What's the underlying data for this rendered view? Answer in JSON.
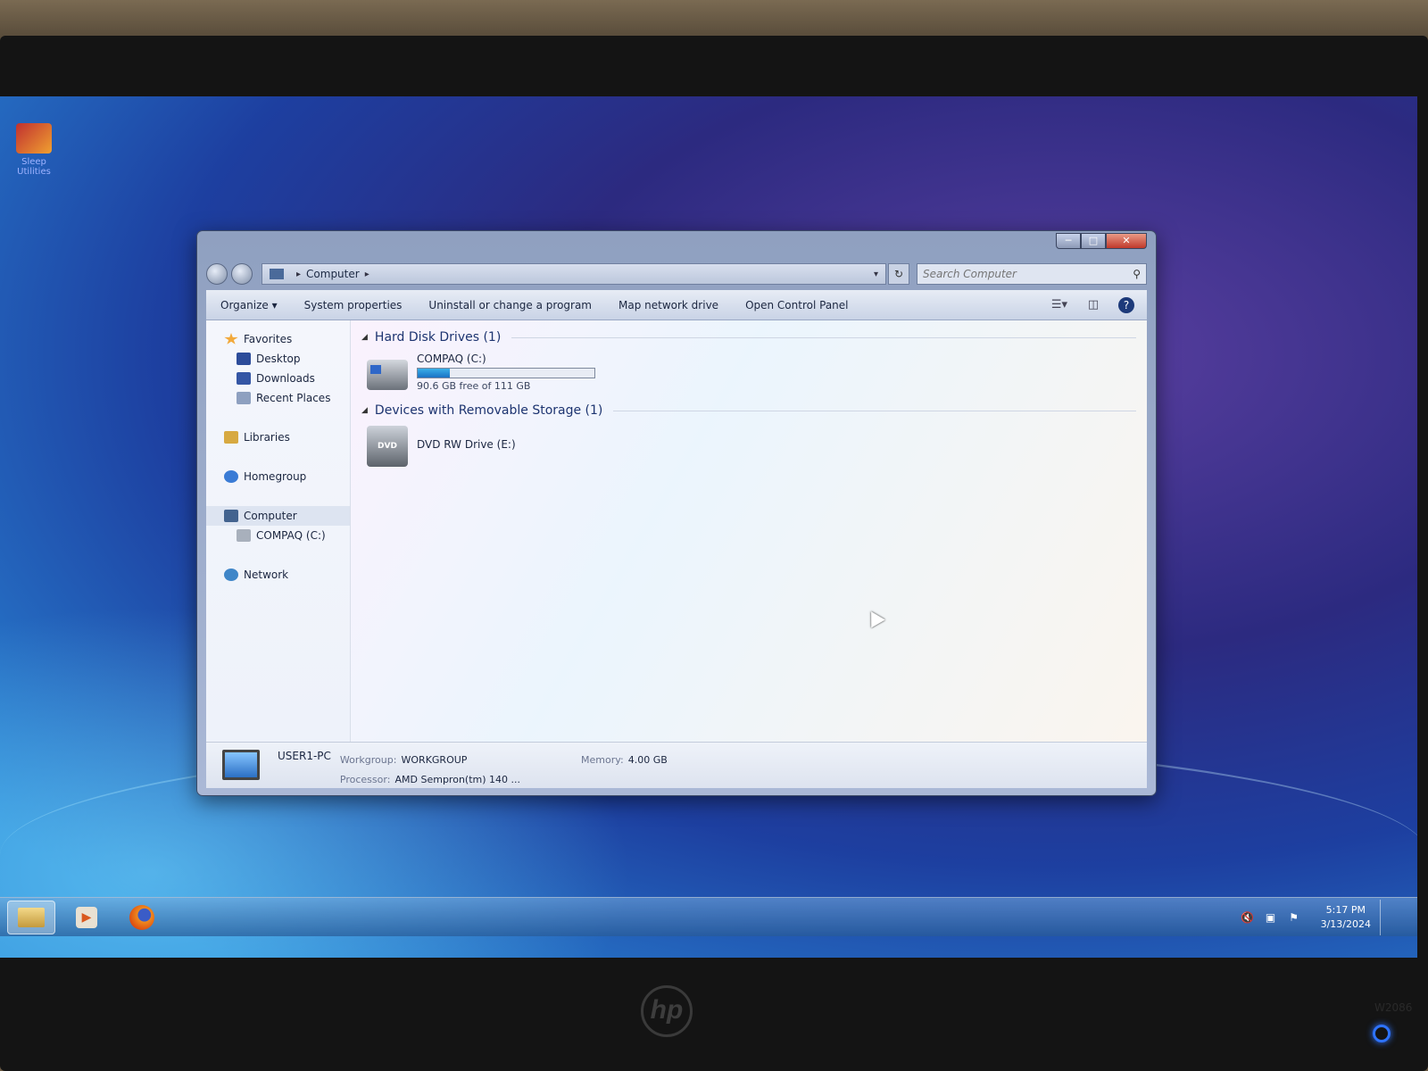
{
  "monitor": {
    "brand": "hp",
    "model": "W2086"
  },
  "desktop": {
    "icon_label": "Sleep Utilities"
  },
  "window": {
    "address": {
      "crumb": "Computer"
    },
    "search": {
      "placeholder": "Search Computer"
    },
    "commands": [
      "Organize",
      "System properties",
      "Uninstall or change a program",
      "Map network drive",
      "Open Control Panel"
    ],
    "nav": {
      "favorites": "Favorites",
      "desktop": "Desktop",
      "downloads": "Downloads",
      "recent": "Recent Places",
      "libraries": "Libraries",
      "homegroup": "Homegroup",
      "computer": "Computer",
      "drive_c": "COMPAQ (C:)",
      "network": "Network"
    },
    "groups": {
      "hdd": {
        "title": "Hard Disk Drives (1)",
        "name": "COMPAQ (C:)",
        "space": "90.6 GB free of 111 GB",
        "used_fraction": 0.18
      },
      "removable": {
        "title": "Devices with Removable Storage (1)",
        "name": "DVD RW Drive (E:)",
        "badge": "DVD"
      }
    },
    "details": {
      "name": "USER1-PC",
      "workgroup_label": "Workgroup:",
      "workgroup": "WORKGROUP",
      "memory_label": "Memory:",
      "memory": "4.00 GB",
      "processor_label": "Processor:",
      "processor": "AMD Sempron(tm) 140 ..."
    }
  },
  "taskbar": {
    "time": "5:17 PM",
    "date": "3/13/2024"
  }
}
